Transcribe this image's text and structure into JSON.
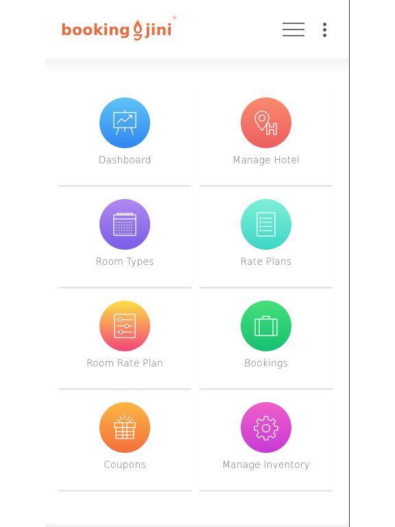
{
  "header": {
    "logo_text_left": "booking",
    "logo_text_right": "jini",
    "logo_reg": "®",
    "brand_color": "#ef6a3a",
    "menu_icon": "hamburger-icon",
    "more_icon": "kebab-icon"
  },
  "tiles": [
    {
      "label": "Dashboard",
      "icon": "presentation-chart-icon",
      "gradient": [
        "#5fc3f7",
        "#2f86f0"
      ]
    },
    {
      "label": "Manage Hotel",
      "icon": "hotel-location-icon",
      "gradient": [
        "#fb8a6e",
        "#eb5e5e"
      ]
    },
    {
      "label": "Room Types",
      "icon": "calendar-icon",
      "gradient": [
        "#b08af0",
        "#7a5ce6"
      ]
    },
    {
      "label": "Rate Plans",
      "icon": "checklist-icon",
      "gradient": [
        "#7ef0d6",
        "#3cd6c6"
      ]
    },
    {
      "label": "Room Rate Plan",
      "icon": "sliders-icon",
      "gradient": [
        "#fce043",
        "#f3437a"
      ]
    },
    {
      "label": "Bookings",
      "icon": "briefcase-icon",
      "gradient": [
        "#45e07a",
        "#15c070"
      ]
    },
    {
      "label": "Coupons",
      "icon": "gift-box-icon",
      "gradient": [
        "#fbb843",
        "#f56d3a"
      ]
    },
    {
      "label": "Manage Inventory",
      "icon": "gear-icon",
      "gradient": [
        "#f05fc8",
        "#c63ad6"
      ]
    }
  ]
}
